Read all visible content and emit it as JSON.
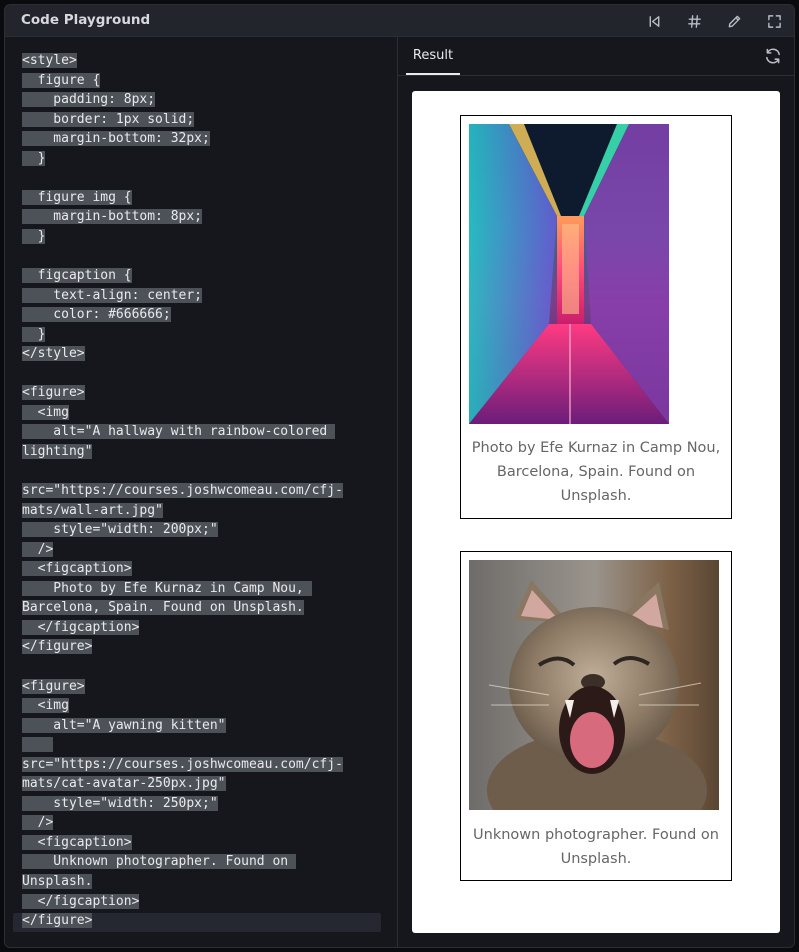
{
  "window": {
    "title": "Code Playground"
  },
  "toolbar": {
    "icons": [
      "skip-back-icon",
      "hash-icon",
      "pencil-icon",
      "fullscreen-icon"
    ]
  },
  "editor": {
    "lines": [
      "<style>",
      "  figure {",
      "    padding: 8px;",
      "    border: 1px solid;",
      "    margin-bottom: 32px;",
      "  }",
      "",
      "  figure img {",
      "    margin-bottom: 8px;",
      "  }",
      "",
      "  figcaption {",
      "    text-align: center;",
      "    color: #666666;",
      "  }",
      "</style>",
      "",
      "<figure>",
      "  <img",
      "    alt=\"A hallway with rainbow-colored ",
      "lighting\"",
      "",
      "src=\"https://courses.joshwcomeau.com/cfj-",
      "mats/wall-art.jpg\"",
      "    style=\"width: 200px;\"",
      "  />",
      "  <figcaption>",
      "    Photo by Efe Kurnaz in Camp Nou, ",
      "Barcelona, Spain. Found on Unsplash.",
      "  </figcaption>",
      "</figure>",
      "",
      "<figure>",
      "  <img",
      "    alt=\"A yawning kitten\"",
      "    ",
      "src=\"https://courses.joshwcomeau.com/cfj-",
      "mats/cat-avatar-250px.jpg\"",
      "    style=\"width: 250px;\"",
      "  />",
      "  <figcaption>",
      "    Unknown photographer. Found on ",
      "Unsplash.",
      "  </figcaption>",
      "</figure>"
    ]
  },
  "result": {
    "tab_label": "Result",
    "figures": [
      {
        "caption": "Photo by Efe Kurnaz in Camp Nou, Barcelona, Spain. Found on Unsplash."
      },
      {
        "caption": "Unknown photographer. Found on Unsplash."
      }
    ]
  },
  "colors": {
    "background": "#15171c",
    "selection": "#4d5158",
    "caption": "#666666"
  }
}
